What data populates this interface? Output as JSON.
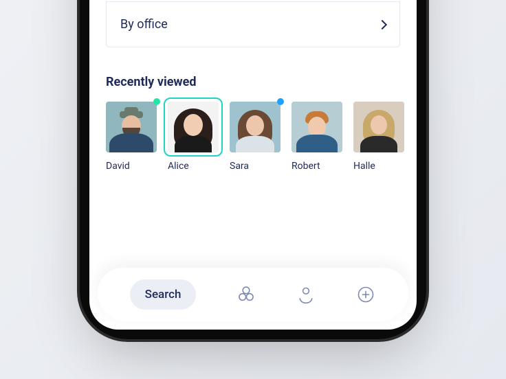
{
  "filter": {
    "by_office_label": "By office"
  },
  "recently_viewed": {
    "heading": "Recently viewed",
    "people": [
      {
        "name": "David",
        "status": "green",
        "selected": false
      },
      {
        "name": "Alice",
        "status": null,
        "selected": true
      },
      {
        "name": "Sara",
        "status": "blue",
        "selected": false
      },
      {
        "name": "Robert",
        "status": null,
        "selected": false
      },
      {
        "name": "Halle",
        "status": null,
        "selected": false
      }
    ]
  },
  "nav": {
    "search_label": "Search"
  },
  "colors": {
    "text_primary": "#1e2a5a",
    "accent_selected": "#1fd4c4",
    "status_green": "#22e6a8",
    "status_blue": "#19a3ff",
    "nav_icon": "#7d89b0"
  }
}
